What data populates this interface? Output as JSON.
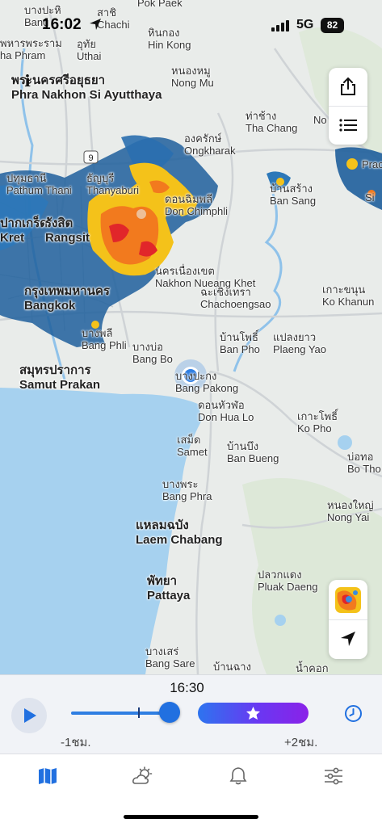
{
  "status_bar": {
    "time": "16:02",
    "network": "5G",
    "battery": "82",
    "icons": [
      "location-arrow-icon",
      "signal-icon"
    ]
  },
  "map": {
    "water_color": "#a6d1ef",
    "land_color": "#e9ecea",
    "radar_colors": [
      "#1f5f9c",
      "#f4c21a",
      "#f27a1e",
      "#e1262a"
    ],
    "labels": [
      {
        "id": "bangpa",
        "thai": "บางปะหิ",
        "en": "Bang"
      },
      {
        "id": "sakhon",
        "thai": "สาชิ",
        "en": "Chachi"
      },
      {
        "id": "pokpaek",
        "thai": "",
        "en": "Pok Paek"
      },
      {
        "id": "hinkong",
        "thai": "หินกอง",
        "en": "Hin Kong"
      },
      {
        "id": "phraram",
        "thai": "พหารพระราม",
        "en": "ha Phram"
      },
      {
        "id": "uthai",
        "thai": "อุทัย",
        "en": "Uthai"
      },
      {
        "id": "nongmu",
        "thai": "หนองหมู",
        "en": "Nong Mu"
      },
      {
        "id": "ayutthaya",
        "thai": "พระนครศรีอยุธยา",
        "en": "Phra Nakhon Si Ayutthaya"
      },
      {
        "id": "thachang",
        "thai": "ท่าช้าง",
        "en": "Tha Chang"
      },
      {
        "id": "no",
        "thai": "",
        "en": "No"
      },
      {
        "id": "ongkharak",
        "thai": "องครักษ์",
        "en": "Ongkharak"
      },
      {
        "id": "pathum",
        "thai": "ปทุมธานี",
        "en": "Pathum Thani"
      },
      {
        "id": "thanyaburi",
        "thai": "ธัญบุรี",
        "en": "Thanyaburi"
      },
      {
        "id": "donchimphli",
        "thai": "ดอนฉิมพลี",
        "en": "Don Chimphli"
      },
      {
        "id": "bansang",
        "thai": "บ้านสร้าง",
        "en": "Ban Sang"
      },
      {
        "id": "prachin",
        "thai": "",
        "en": "Prac"
      },
      {
        "id": "si",
        "thai": "",
        "en": "Si"
      },
      {
        "id": "kret",
        "thai": "ปากเกร็ด",
        "en": "Kret"
      },
      {
        "id": "rangsit",
        "thai": "รังสิต",
        "en": "Rangsit"
      },
      {
        "id": "nakhonnueang",
        "thai": "นครเนื่องเขต",
        "en": "Nakhon Nueang Khet"
      },
      {
        "id": "bangkok",
        "thai": "กรุงเทพมหานคร",
        "en": "Bangkok"
      },
      {
        "id": "chachoengsao",
        "thai": "ฉะเชิงเทรา",
        "en": "Chachoengsao"
      },
      {
        "id": "kokhanun",
        "thai": "เกาะขนุน",
        "en": "Ko Khanun"
      },
      {
        "id": "bangphli",
        "thai": "บางพลี",
        "en": "Bang Phli"
      },
      {
        "id": "bangbo",
        "thai": "บางบ่อ",
        "en": "Bang Bo"
      },
      {
        "id": "banpho",
        "thai": "บ้านโพธิ์",
        "en": "Ban Pho"
      },
      {
        "id": "plaengyao",
        "thai": "แปลงยาว",
        "en": "Plaeng Yao"
      },
      {
        "id": "samutprakan",
        "thai": "สมุทรปราการ",
        "en": "Samut Prakan"
      },
      {
        "id": "bangpakong",
        "thai": "บางปะกง",
        "en": "Bang Pakong"
      },
      {
        "id": "donhualo",
        "thai": "ดอนหัวฬ่อ",
        "en": "Don Hua Lo"
      },
      {
        "id": "kopho",
        "thai": "เกาะโพธิ์",
        "en": "Ko Pho"
      },
      {
        "id": "samet",
        "thai": "เสม็ด",
        "en": "Samet"
      },
      {
        "id": "banbueng",
        "thai": "บ้านบึง",
        "en": "Ban Bueng"
      },
      {
        "id": "botho",
        "thai": "บ่อทอ",
        "en": "Bo Tho"
      },
      {
        "id": "bangphra",
        "thai": "บางพระ",
        "en": "Bang Phra"
      },
      {
        "id": "nongyai",
        "thai": "หนองใหญ่",
        "en": "Nong Yai"
      },
      {
        "id": "laemchabang",
        "thai": "แหลมฉบัง",
        "en": "Laem Chabang"
      },
      {
        "id": "pluakdaeng",
        "thai": "ปลวกแดง",
        "en": "Pluak Daeng"
      },
      {
        "id": "pattaya",
        "thai": "พัทยา",
        "en": "Pattaya"
      },
      {
        "id": "bangsare",
        "thai": "บางเสร่",
        "en": "Bang Sare"
      },
      {
        "id": "banchang",
        "thai": "บ้านฉาง",
        "en": "บ้านฉาง"
      },
      {
        "id": "namkhok",
        "thai": "น้ำคอก",
        "en": "น้ำคอก"
      }
    ],
    "highway_shield": "9"
  },
  "controls": {
    "time": "16:30",
    "minus_label": "-1ชม.",
    "plus_label": "+2ชม.",
    "accent": "#2170e0"
  },
  "tabs": [
    {
      "id": "map",
      "icon": "map-icon",
      "active": true
    },
    {
      "id": "weather",
      "icon": "weather-icon",
      "active": false
    },
    {
      "id": "alerts",
      "icon": "bell-icon",
      "active": false
    },
    {
      "id": "settings",
      "icon": "sliders-icon",
      "active": false
    }
  ]
}
